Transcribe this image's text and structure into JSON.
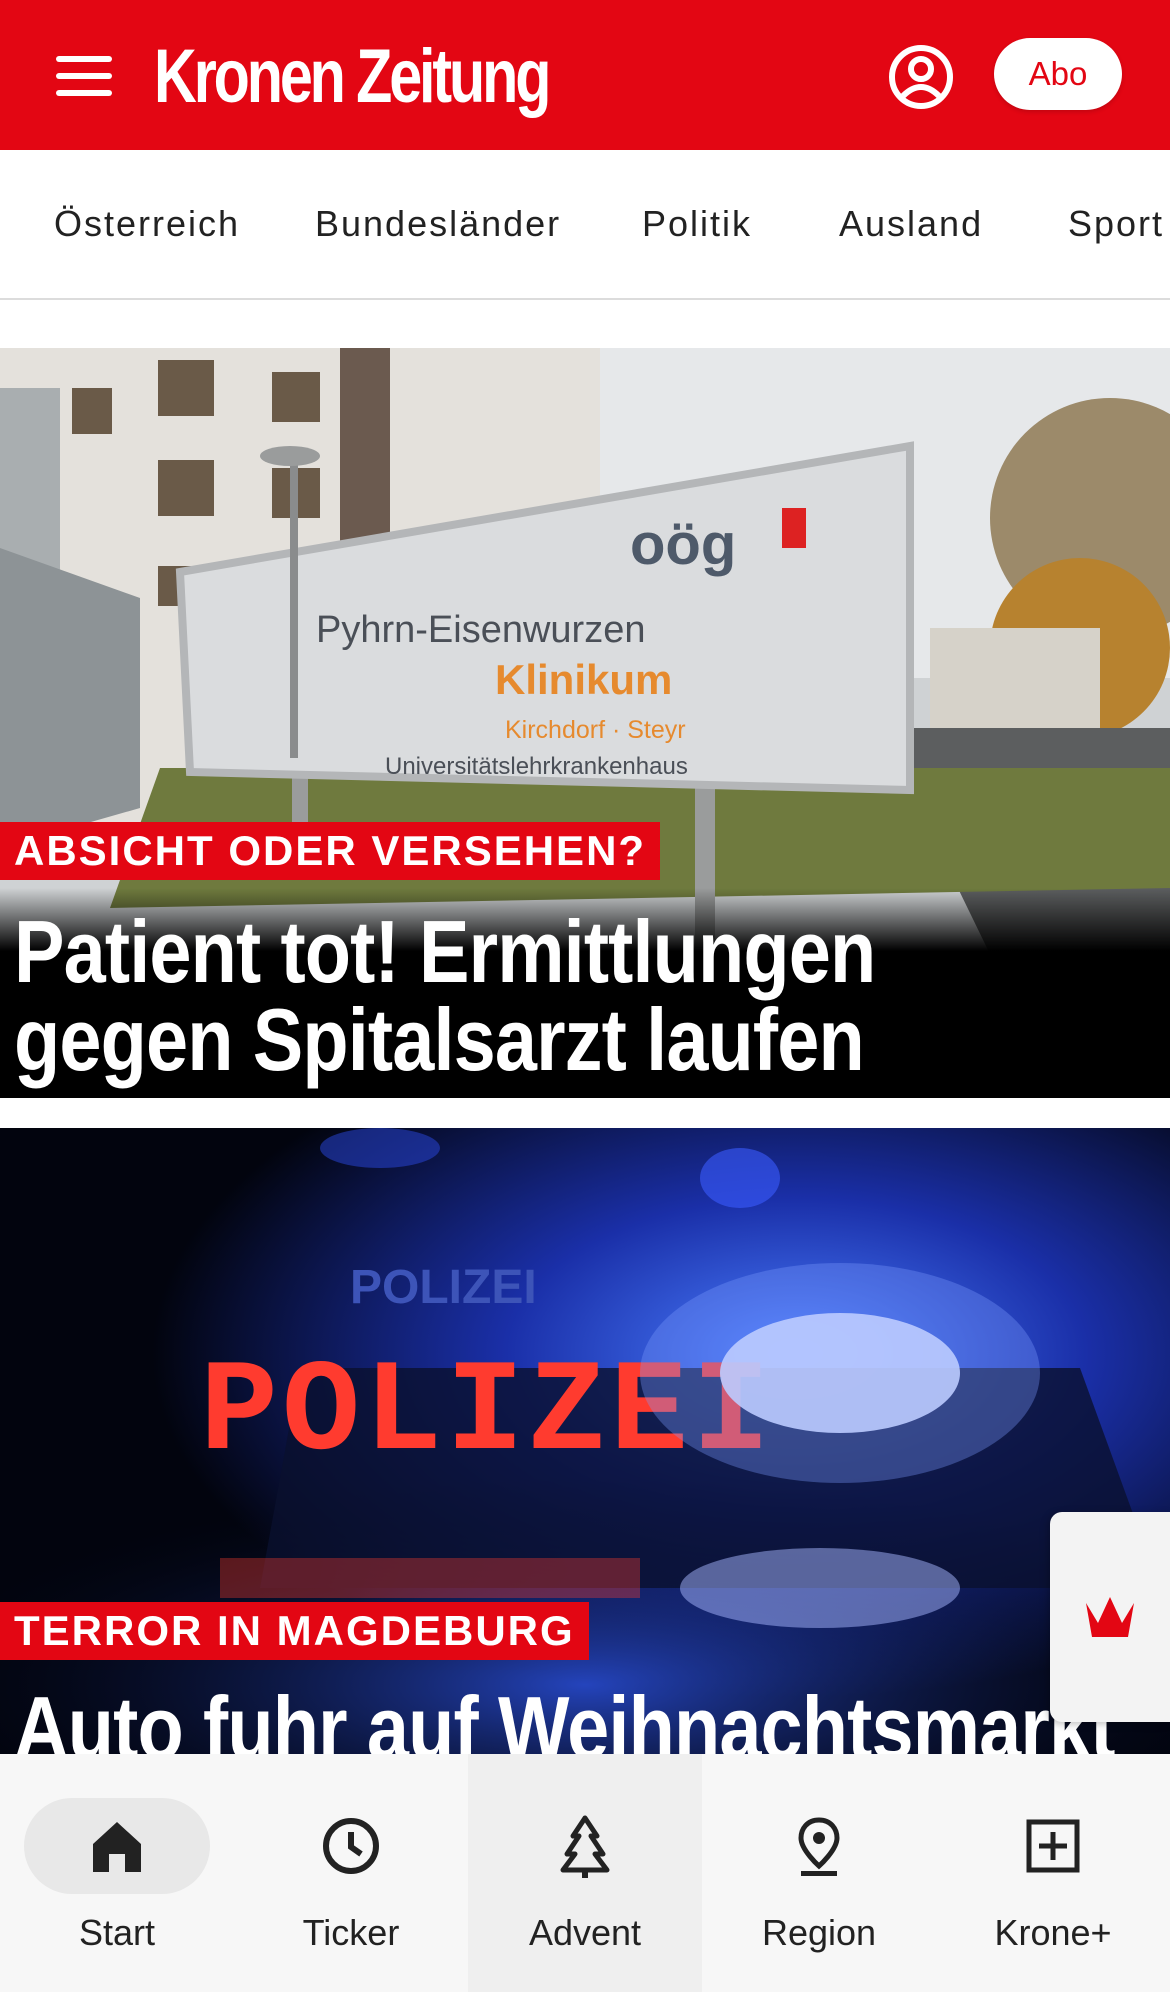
{
  "header": {
    "logo": "Kronen Zeitung",
    "abo_label": "Abo",
    "brand_color": "#e30613"
  },
  "categories": [
    "Österreich",
    "Bundesländer",
    "Politik",
    "Ausland",
    "Sport"
  ],
  "articles": [
    {
      "kicker": "ABSICHT ODER VERSEHEN?",
      "headline_line1": "Patient tot! Ermittlungen",
      "headline_line2": "gegen Spitalsarzt laufen",
      "image": {
        "sign_logo": "oög",
        "sign_line1": "Pyhrn-Eisenwurzen",
        "sign_line2": "Klinikum",
        "sign_line3": "Kirchdorf · Steyr",
        "sign_line4": "Universitätslehrkrankenhaus"
      }
    },
    {
      "kicker": "TERROR IN MAGDEBURG",
      "headline_line1": "Auto fuhr auf Weihnachtsmarkt",
      "image": {
        "sign_small": "POLIZEI",
        "sign_led": "POLIZEI"
      }
    }
  ],
  "bottom_nav": [
    {
      "label": "Start",
      "icon": "home-icon"
    },
    {
      "label": "Ticker",
      "icon": "clock-icon"
    },
    {
      "label": "Advent",
      "icon": "tree-icon"
    },
    {
      "label": "Region",
      "icon": "location-pin-icon"
    },
    {
      "label": "Krone+",
      "icon": "plus-box-icon"
    }
  ]
}
